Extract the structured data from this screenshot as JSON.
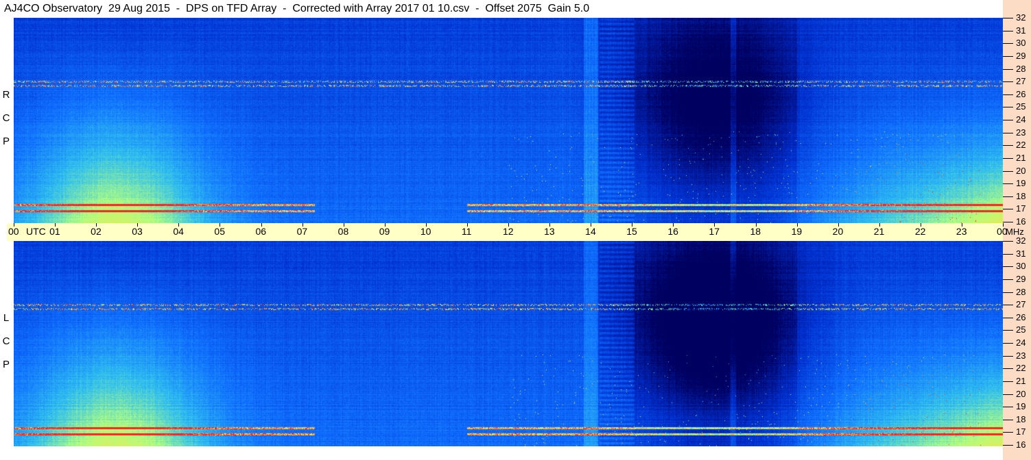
{
  "title": "AJ4CO Observatory  29 Aug 2015  -  DPS on TFD Array  -  Corrected with Array 2017 01 10.csv  -  Offset 2075  Gain 5.0",
  "chart_data": [
    {
      "type": "heatmap",
      "polarization": [
        "R",
        "C",
        "P"
      ],
      "x_unit": "UTC",
      "y_unit": "MHz",
      "xlim": [
        "00",
        "00"
      ],
      "ylim": [
        16,
        32
      ],
      "x_ticks": [
        "00",
        "01",
        "02",
        "03",
        "04",
        "05",
        "06",
        "07",
        "08",
        "09",
        "10",
        "11",
        "12",
        "13",
        "14",
        "15",
        "16",
        "17",
        "18",
        "19",
        "20",
        "21",
        "22",
        "23",
        "00"
      ],
      "y_ticks": [
        "16",
        "17",
        "18",
        "19",
        "20",
        "21",
        "22",
        "23",
        "24",
        "25",
        "26",
        "27",
        "28",
        "29",
        "30",
        "31",
        "32"
      ],
      "colormap": [
        "#000060",
        "#0030d0",
        "#1070ff",
        "#30c0f0",
        "#b0ff80",
        "#ffe040",
        "#ff2020"
      ]
    },
    {
      "type": "heatmap",
      "polarization": [
        "L",
        "C",
        "P"
      ],
      "x_unit": "UTC",
      "y_unit": "MHz",
      "xlim": [
        "00",
        "00"
      ],
      "ylim": [
        16,
        32
      ],
      "x_ticks": [
        "00",
        "01",
        "02",
        "03",
        "04",
        "05",
        "06",
        "07",
        "08",
        "09",
        "10",
        "11",
        "12",
        "13",
        "14",
        "15",
        "16",
        "17",
        "18",
        "19",
        "20",
        "21",
        "22",
        "23",
        "00"
      ],
      "y_ticks": [
        "16",
        "17",
        "18",
        "19",
        "20",
        "21",
        "22",
        "23",
        "24",
        "25",
        "26",
        "27",
        "28",
        "29",
        "30",
        "31",
        "32"
      ],
      "colormap": [
        "#000060",
        "#0030d0",
        "#1070ff",
        "#30c0f0",
        "#b0ff80",
        "#ffe040",
        "#ff2020"
      ]
    }
  ],
  "axis": {
    "utc_label": "UTC",
    "mhz_label": "MHz"
  }
}
